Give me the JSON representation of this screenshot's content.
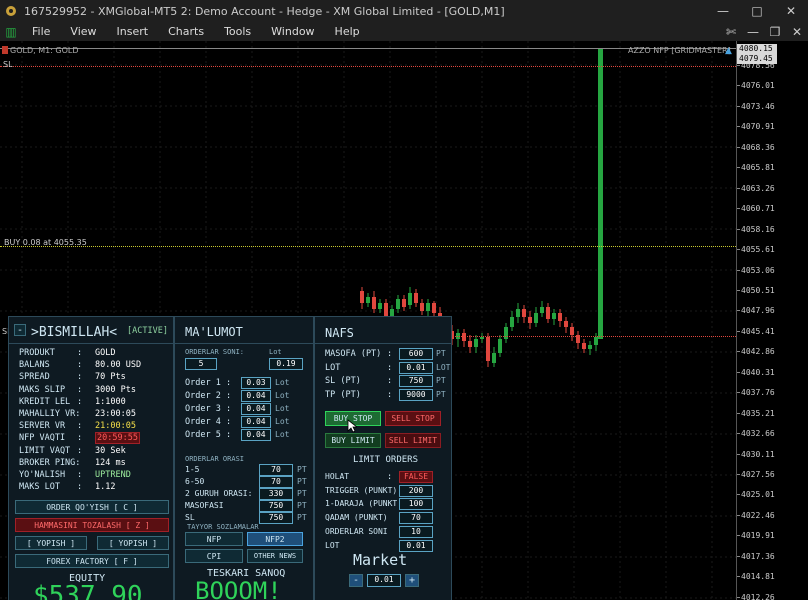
{
  "window": {
    "title": "167529952 - XMGlobal-MT5 2: Demo Account - Hedge - XM Global Limited - [GOLD,M1]",
    "controls": [
      "—",
      "□",
      "✕"
    ]
  },
  "menu": {
    "items": [
      "File",
      "View",
      "Insert",
      "Charts",
      "Tools",
      "Window",
      "Help"
    ]
  },
  "chart": {
    "symbol_label": "GOLD, M1: GOLD",
    "ea_label": "AZZO NFP [GRIDMASTER]",
    "sl_label": "SL",
    "buy_label": "BUY 0.08 at 4055.35",
    "sl_left_label": "SL",
    "price_boxes": [
      "4080.15",
      "4079.45"
    ],
    "price_ticks": [
      "4078.56",
      "4076.01",
      "4073.46",
      "4070.91",
      "4068.36",
      "4065.81",
      "4063.26",
      "4060.71",
      "4058.16",
      "4055.61",
      "4053.06",
      "4050.51",
      "4047.96",
      "4045.41",
      "4042.86",
      "4040.31",
      "4037.76",
      "4035.21",
      "4032.66",
      "4030.11",
      "4027.56",
      "4025.01",
      "4022.46",
      "4019.91",
      "4017.36",
      "4014.81",
      "4012.26"
    ],
    "colors": {
      "bull": "#26a641",
      "bear": "#e0473e",
      "buy_line": "#c8c830",
      "sl_line": "#e0473e"
    }
  },
  "panel_main": {
    "title": ">BISMILLAH<",
    "status": "[ACTIVE]",
    "collapse": "-",
    "rows": [
      {
        "label": "PRODUKT",
        "sep": ":",
        "value": "GOLD"
      },
      {
        "label": "BALANS",
        "sep": ":",
        "value": "80.00 USD"
      },
      {
        "label": "SPREAD",
        "sep": ":",
        "value": "70 Pts"
      },
      {
        "label": "MAKS SLIP",
        "sep": ":",
        "value": "3000 Pts"
      },
      {
        "label": "KREDIT LEL",
        "sep": ":",
        "value": "1:1000"
      },
      {
        "label": "MAHALLIY VR:",
        "sep": "",
        "value": "23:00:05"
      },
      {
        "label": "SERVER VR",
        "sep": ":",
        "value": "21:00:05"
      },
      {
        "label": "NFP VAQTI",
        "sep": ":",
        "value": "20:59:55"
      },
      {
        "label": "LIMIT VAQT",
        "sep": ":",
        "value": "30 Sek"
      },
      {
        "label": "BROKER PING:",
        "sep": "",
        "value": "124 ms"
      },
      {
        "label": "YO'NALISH",
        "sep": ":",
        "value": "UPTREND"
      },
      {
        "label": "MAKS LOT",
        "sep": ":",
        "value": "1.12"
      }
    ],
    "order_button": "ORDER QO'YISH [ C ]",
    "close_all_button": "HAMMASINI TOZALASH [ Z ]",
    "close_left": "[ YOPISH ]",
    "close_right": "[ YOPISH ]",
    "forex_button": "FOREX FACTORY [ F ]",
    "equity_label": "EQUITY",
    "equity_value": "$537.90"
  },
  "panel_info": {
    "title": "MA'LUMOT",
    "order_count_label": "ORDERLAR SONI:",
    "lot_label": "Lot",
    "order_count": "5",
    "lot_value": "0.19",
    "orders": [
      {
        "label": "Order 1 :",
        "value": "0.03",
        "unit": "Lot"
      },
      {
        "label": "Order 2 :",
        "value": "0.04",
        "unit": "Lot"
      },
      {
        "label": "Order 3 :",
        "value": "0.04",
        "unit": "Lot"
      },
      {
        "label": "Order 4 :",
        "value": "0.04",
        "unit": "Lot"
      },
      {
        "label": "Order 5 :",
        "value": "0.04",
        "unit": "Lot"
      }
    ],
    "distance_title": "ORDERLAR ORASI",
    "distances": [
      {
        "label": "1-5",
        "value": "70",
        "unit": "PT"
      },
      {
        "label": "6-50",
        "value": "70",
        "unit": "PT"
      },
      {
        "label": "2 GURUH ORASI:",
        "value": "330",
        "unit": "PT"
      },
      {
        "label": "MASOFASI",
        "value": "750",
        "unit": "PT"
      },
      {
        "label": "SL",
        "value": "750",
        "unit": "PT"
      }
    ],
    "presets_title": "TAYYOR SOZLAMALAR",
    "preset_nfp": "NFP",
    "preset_nfp2": "NFP2",
    "preset_cpi": "CPI",
    "preset_other": "OTHER NEWS",
    "reverse_label": "TESKARI SANOQ",
    "reverse_value": "BOOOM!"
  },
  "panel_nafs": {
    "title": "NAFS",
    "rows": [
      {
        "label": "MASOFA (PT)",
        "sep": ":",
        "value": "600",
        "unit": "PT"
      },
      {
        "label": "LOT",
        "sep": ":",
        "value": "0.01",
        "unit": "LOT"
      },
      {
        "label": "SL (PT)",
        "sep": ":",
        "value": "750",
        "unit": "PT"
      },
      {
        "label": "TP (PT)",
        "sep": ":",
        "value": "9000",
        "unit": "PT"
      }
    ],
    "buy_stop": "BUY STOP",
    "sell_stop": "SELL STOP",
    "buy_limit": "BUY LIMIT",
    "sell_limit": "SELL LIMIT",
    "limit_title": "LIMIT ORDERS",
    "limit_rows": [
      {
        "label": "HOLAT",
        "sep": ":",
        "value": "FALSE"
      },
      {
        "label": "TRIGGER (PUNKT)",
        "sep": "",
        "value": "200"
      },
      {
        "label": "1-DARAJA (PUNKT)",
        "sep": "",
        "value": "100"
      },
      {
        "label": "QADAM (PUNKT)",
        "sep": "",
        "value": "70"
      },
      {
        "label": "ORDERLAR SONI",
        "sep": "",
        "value": "10"
      },
      {
        "label": "LOT",
        "sep": "",
        "value": "0.01"
      }
    ],
    "market_label": "Market",
    "minus": "-",
    "market_lot": "0.01",
    "plus": "+"
  }
}
